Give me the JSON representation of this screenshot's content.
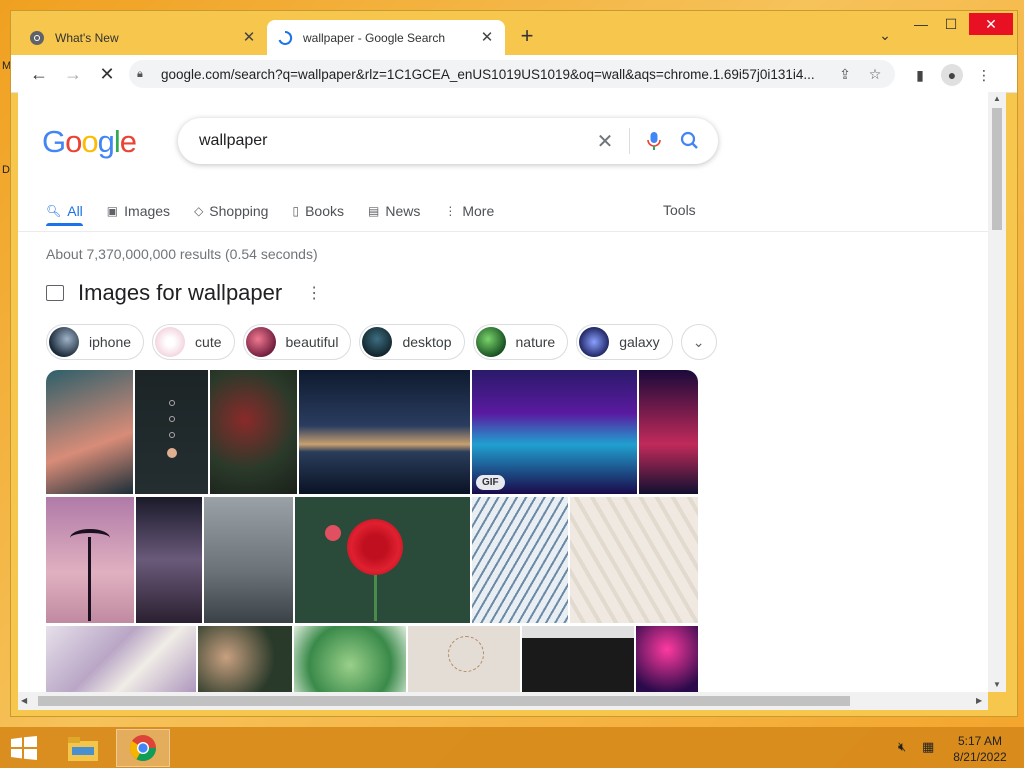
{
  "desktop": {
    "left_glyph_top": "M",
    "left_glyph_mid": "D"
  },
  "browser": {
    "tabs": [
      {
        "title": "What's New",
        "icon": "chrome-icon",
        "active": false
      },
      {
        "title": "wallpaper - Google Search",
        "icon": "loading-spinner-icon",
        "active": true
      }
    ],
    "url": "google.com/search?q=wallpaper&rlz=1C1GCEA_enUS1019US1019&oq=wall&aqs=chrome.1.69i57j0i131i4...",
    "window_controls": [
      "minimize-icon",
      "maximize-icon",
      "close-icon"
    ]
  },
  "google": {
    "logo": [
      "G",
      "o",
      "o",
      "g",
      "l",
      "e"
    ],
    "search_value": "wallpaper",
    "nav_tabs": [
      {
        "label": "All",
        "icon": "search-icon"
      },
      {
        "label": "Images",
        "icon": "image-icon"
      },
      {
        "label": "Shopping",
        "icon": "tag-icon"
      },
      {
        "label": "Books",
        "icon": "book-icon"
      },
      {
        "label": "News",
        "icon": "news-icon"
      },
      {
        "label": "More",
        "icon": "more-vert-icon"
      }
    ],
    "tools_label": "Tools",
    "result_stats": "About 7,370,000,000 results (0.54 seconds)",
    "images_header": "Images for wallpaper",
    "chips": [
      {
        "label": "iphone",
        "color": "#1b2a3a"
      },
      {
        "label": "cute",
        "color": "#f3d7e0"
      },
      {
        "label": "beautiful",
        "color": "#c43a50"
      },
      {
        "label": "desktop",
        "color": "#1f3d4a"
      },
      {
        "label": "nature",
        "color": "#2f8a3c"
      },
      {
        "label": "galaxy",
        "color": "#2a3a9a"
      }
    ],
    "gif_badge": "GIF"
  },
  "taskbar": {
    "apps": [
      "file-explorer-icon",
      "chrome-icon"
    ],
    "time": "5:17 AM",
    "date": "8/21/2022"
  },
  "colors": {
    "accent": "#1a73e8",
    "desktop": "#f4a52c",
    "titlebar": "#f7c64d"
  }
}
